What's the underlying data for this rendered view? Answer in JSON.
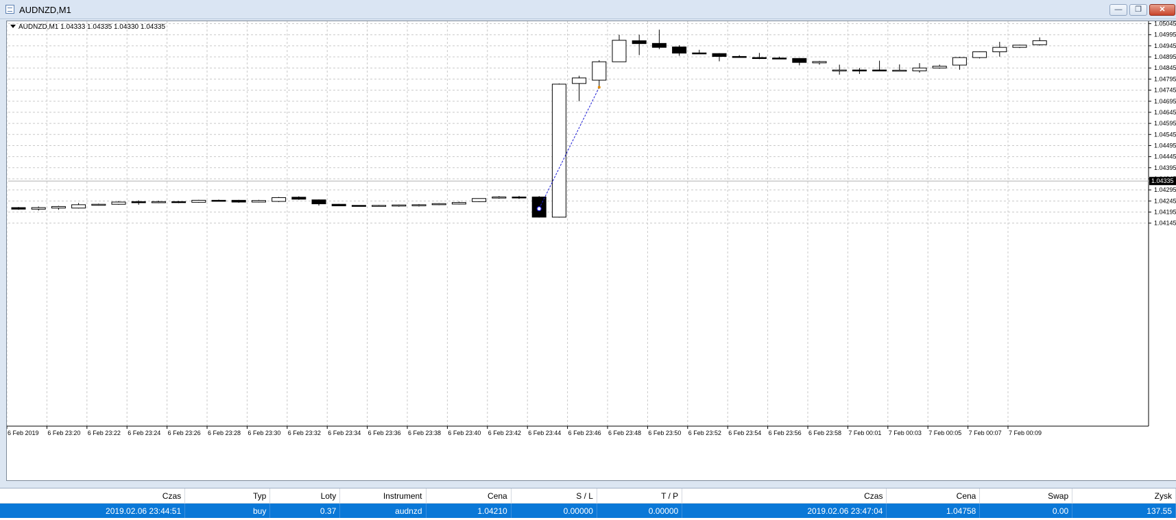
{
  "window": {
    "title": "AUDNZD,M1",
    "minimize_glyph": "—",
    "maximize_glyph": "❐",
    "close_glyph": "✕"
  },
  "chart": {
    "header_text": "AUDNZD,M1  1.04333 1.04335 1.04330 1.04335"
  },
  "chart_data": {
    "type": "candlestick",
    "symbol": "AUDNZD",
    "timeframe": "M1",
    "ylim": [
      1.04125,
      1.05025
    ],
    "y_ticks": [
      "1.05045",
      "1.04995",
      "1.04945",
      "1.04895",
      "1.04845",
      "1.04795",
      "1.04745",
      "1.04695",
      "1.04645",
      "1.04595",
      "1.04545",
      "1.04495",
      "1.04445",
      "1.04395",
      "1.04345",
      "1.04295",
      "1.04245",
      "1.04195",
      "1.04145"
    ],
    "current_price": "1.04335",
    "x_labels": [
      "6 Feb 2019",
      "6 Feb 23:20",
      "6 Feb 23:22",
      "6 Feb 23:24",
      "6 Feb 23:26",
      "6 Feb 23:28",
      "6 Feb 23:30",
      "6 Feb 23:32",
      "6 Feb 23:34",
      "6 Feb 23:36",
      "6 Feb 23:38",
      "6 Feb 23:40",
      "6 Feb 23:42",
      "6 Feb 23:44",
      "6 Feb 23:46",
      "6 Feb 23:48",
      "6 Feb 23:50",
      "6 Feb 23:52",
      "6 Feb 23:54",
      "6 Feb 23:56",
      "6 Feb 23:58",
      "7 Feb 00:01",
      "7 Feb 00:03",
      "7 Feb 00:05",
      "7 Feb 00:07",
      "7 Feb 00:09"
    ],
    "grid": true,
    "candles": [
      {
        "o": 1.04215,
        "h": 1.04218,
        "l": 1.04205,
        "c": 1.04208
      },
      {
        "o": 1.04208,
        "h": 1.0422,
        "l": 1.04202,
        "c": 1.04215
      },
      {
        "o": 1.04213,
        "h": 1.04223,
        "l": 1.04205,
        "c": 1.0422
      },
      {
        "o": 1.04213,
        "h": 1.04236,
        "l": 1.04211,
        "c": 1.04228
      },
      {
        "o": 1.04228,
        "h": 1.04233,
        "l": 1.04224,
        "c": 1.0423
      },
      {
        "o": 1.0423,
        "h": 1.04245,
        "l": 1.04228,
        "c": 1.0424
      },
      {
        "o": 1.04242,
        "h": 1.04248,
        "l": 1.04228,
        "c": 1.04237
      },
      {
        "o": 1.04237,
        "h": 1.04246,
        "l": 1.04235,
        "c": 1.04242
      },
      {
        "o": 1.04242,
        "h": 1.04245,
        "l": 1.04235,
        "c": 1.04238
      },
      {
        "o": 1.04239,
        "h": 1.0425,
        "l": 1.04237,
        "c": 1.04248
      },
      {
        "o": 1.04248,
        "h": 1.04251,
        "l": 1.04243,
        "c": 1.04246
      },
      {
        "o": 1.04248,
        "h": 1.0425,
        "l": 1.04237,
        "c": 1.0424
      },
      {
        "o": 1.0424,
        "h": 1.0425,
        "l": 1.04238,
        "c": 1.04247
      },
      {
        "o": 1.04243,
        "h": 1.04263,
        "l": 1.0424,
        "c": 1.0426
      },
      {
        "o": 1.04262,
        "h": 1.04266,
        "l": 1.0425,
        "c": 1.04253
      },
      {
        "o": 1.0425,
        "h": 1.04252,
        "l": 1.04224,
        "c": 1.04232
      },
      {
        "o": 1.0423,
        "h": 1.04232,
        "l": 1.04222,
        "c": 1.04223
      },
      {
        "o": 1.04225,
        "h": 1.04226,
        "l": 1.0422,
        "c": 1.04222
      },
      {
        "o": 1.04222,
        "h": 1.04227,
        "l": 1.0422,
        "c": 1.04225
      },
      {
        "o": 1.04222,
        "h": 1.04229,
        "l": 1.04219,
        "c": 1.04227
      },
      {
        "o": 1.04224,
        "h": 1.04231,
        "l": 1.0422,
        "c": 1.04228
      },
      {
        "o": 1.04228,
        "h": 1.04235,
        "l": 1.04226,
        "c": 1.04233
      },
      {
        "o": 1.04231,
        "h": 1.04242,
        "l": 1.04229,
        "c": 1.04238
      },
      {
        "o": 1.04242,
        "h": 1.04257,
        "l": 1.0424,
        "c": 1.04256
      },
      {
        "o": 1.04258,
        "h": 1.04267,
        "l": 1.04255,
        "c": 1.04263
      },
      {
        "o": 1.04263,
        "h": 1.04268,
        "l": 1.04254,
        "c": 1.04261
      },
      {
        "o": 1.04263,
        "h": 1.04267,
        "l": 1.0417,
        "c": 1.04172
      },
      {
        "o": 1.04172,
        "h": 1.04775,
        "l": 1.0417,
        "c": 1.04772
      },
      {
        "o": 1.04775,
        "h": 1.0481,
        "l": 1.04695,
        "c": 1.048
      },
      {
        "o": 1.0479,
        "h": 1.0488,
        "l": 1.0476,
        "c": 1.04873
      },
      {
        "o": 1.04873,
        "h": 1.04995,
        "l": 1.04873,
        "c": 1.0497
      },
      {
        "o": 1.04968,
        "h": 1.04995,
        "l": 1.04903,
        "c": 1.04955
      },
      {
        "o": 1.04956,
        "h": 1.05018,
        "l": 1.0493,
        "c": 1.04938
      },
      {
        "o": 1.0494,
        "h": 1.04948,
        "l": 1.049,
        "c": 1.04912
      },
      {
        "o": 1.04913,
        "h": 1.04927,
        "l": 1.0491,
        "c": 1.04911
      },
      {
        "o": 1.0491,
        "h": 1.04912,
        "l": 1.04875,
        "c": 1.04897
      },
      {
        "o": 1.04897,
        "h": 1.04903,
        "l": 1.04893,
        "c": 1.04894
      },
      {
        "o": 1.04892,
        "h": 1.04913,
        "l": 1.04885,
        "c": 1.04891
      },
      {
        "o": 1.0489,
        "h": 1.04896,
        "l": 1.04885,
        "c": 1.04887
      },
      {
        "o": 1.04888,
        "h": 1.0489,
        "l": 1.04857,
        "c": 1.0487
      },
      {
        "o": 1.04868,
        "h": 1.04877,
        "l": 1.0486,
        "c": 1.04874
      },
      {
        "o": 1.04832,
        "h": 1.0486,
        "l": 1.04815,
        "c": 1.04836
      },
      {
        "o": 1.04836,
        "h": 1.04845,
        "l": 1.04818,
        "c": 1.04835
      },
      {
        "o": 1.04836,
        "h": 1.04878,
        "l": 1.04832,
        "c": 1.04834
      },
      {
        "o": 1.04834,
        "h": 1.04861,
        "l": 1.04832,
        "c": 1.04835
      },
      {
        "o": 1.04832,
        "h": 1.04867,
        "l": 1.04824,
        "c": 1.04845
      },
      {
        "o": 1.04845,
        "h": 1.0486,
        "l": 1.04842,
        "c": 1.04853
      },
      {
        "o": 1.04858,
        "h": 1.04895,
        "l": 1.04837,
        "c": 1.04892
      },
      {
        "o": 1.04892,
        "h": 1.0492,
        "l": 1.04888,
        "c": 1.04918
      },
      {
        "o": 1.04918,
        "h": 1.04963,
        "l": 1.04896,
        "c": 1.04938
      },
      {
        "o": 1.04938,
        "h": 1.0495,
        "l": 1.04935,
        "c": 1.04948
      },
      {
        "o": 1.0495,
        "h": 1.04983,
        "l": 1.04946,
        "c": 1.04968
      }
    ],
    "trade": {
      "open_index": 26,
      "open_price": 1.0421,
      "close_index": 29,
      "close_price": 1.04758,
      "color": "#1a1ad6"
    },
    "colors": {
      "bull_body": "#ffffff",
      "bear_body": "#000000",
      "outline": "#000000",
      "grid": "#c8c8c8",
      "close_marker": "#e08a00"
    }
  },
  "terminal": {
    "columns": [
      "Czas",
      "Typ",
      "Loty",
      "Instrument",
      "Cena",
      "S / L",
      "T / P",
      "Czas",
      "Cena",
      "Swap",
      "Zysk"
    ],
    "rows": [
      [
        "2019.02.06 23:44:51",
        "buy",
        "0.37",
        "audnzd",
        "1.04210",
        "0.00000",
        "0.00000",
        "2019.02.06 23:47:04",
        "1.04758",
        "0.00",
        "137.55"
      ]
    ],
    "selected_row_color": "#0a78d7"
  }
}
